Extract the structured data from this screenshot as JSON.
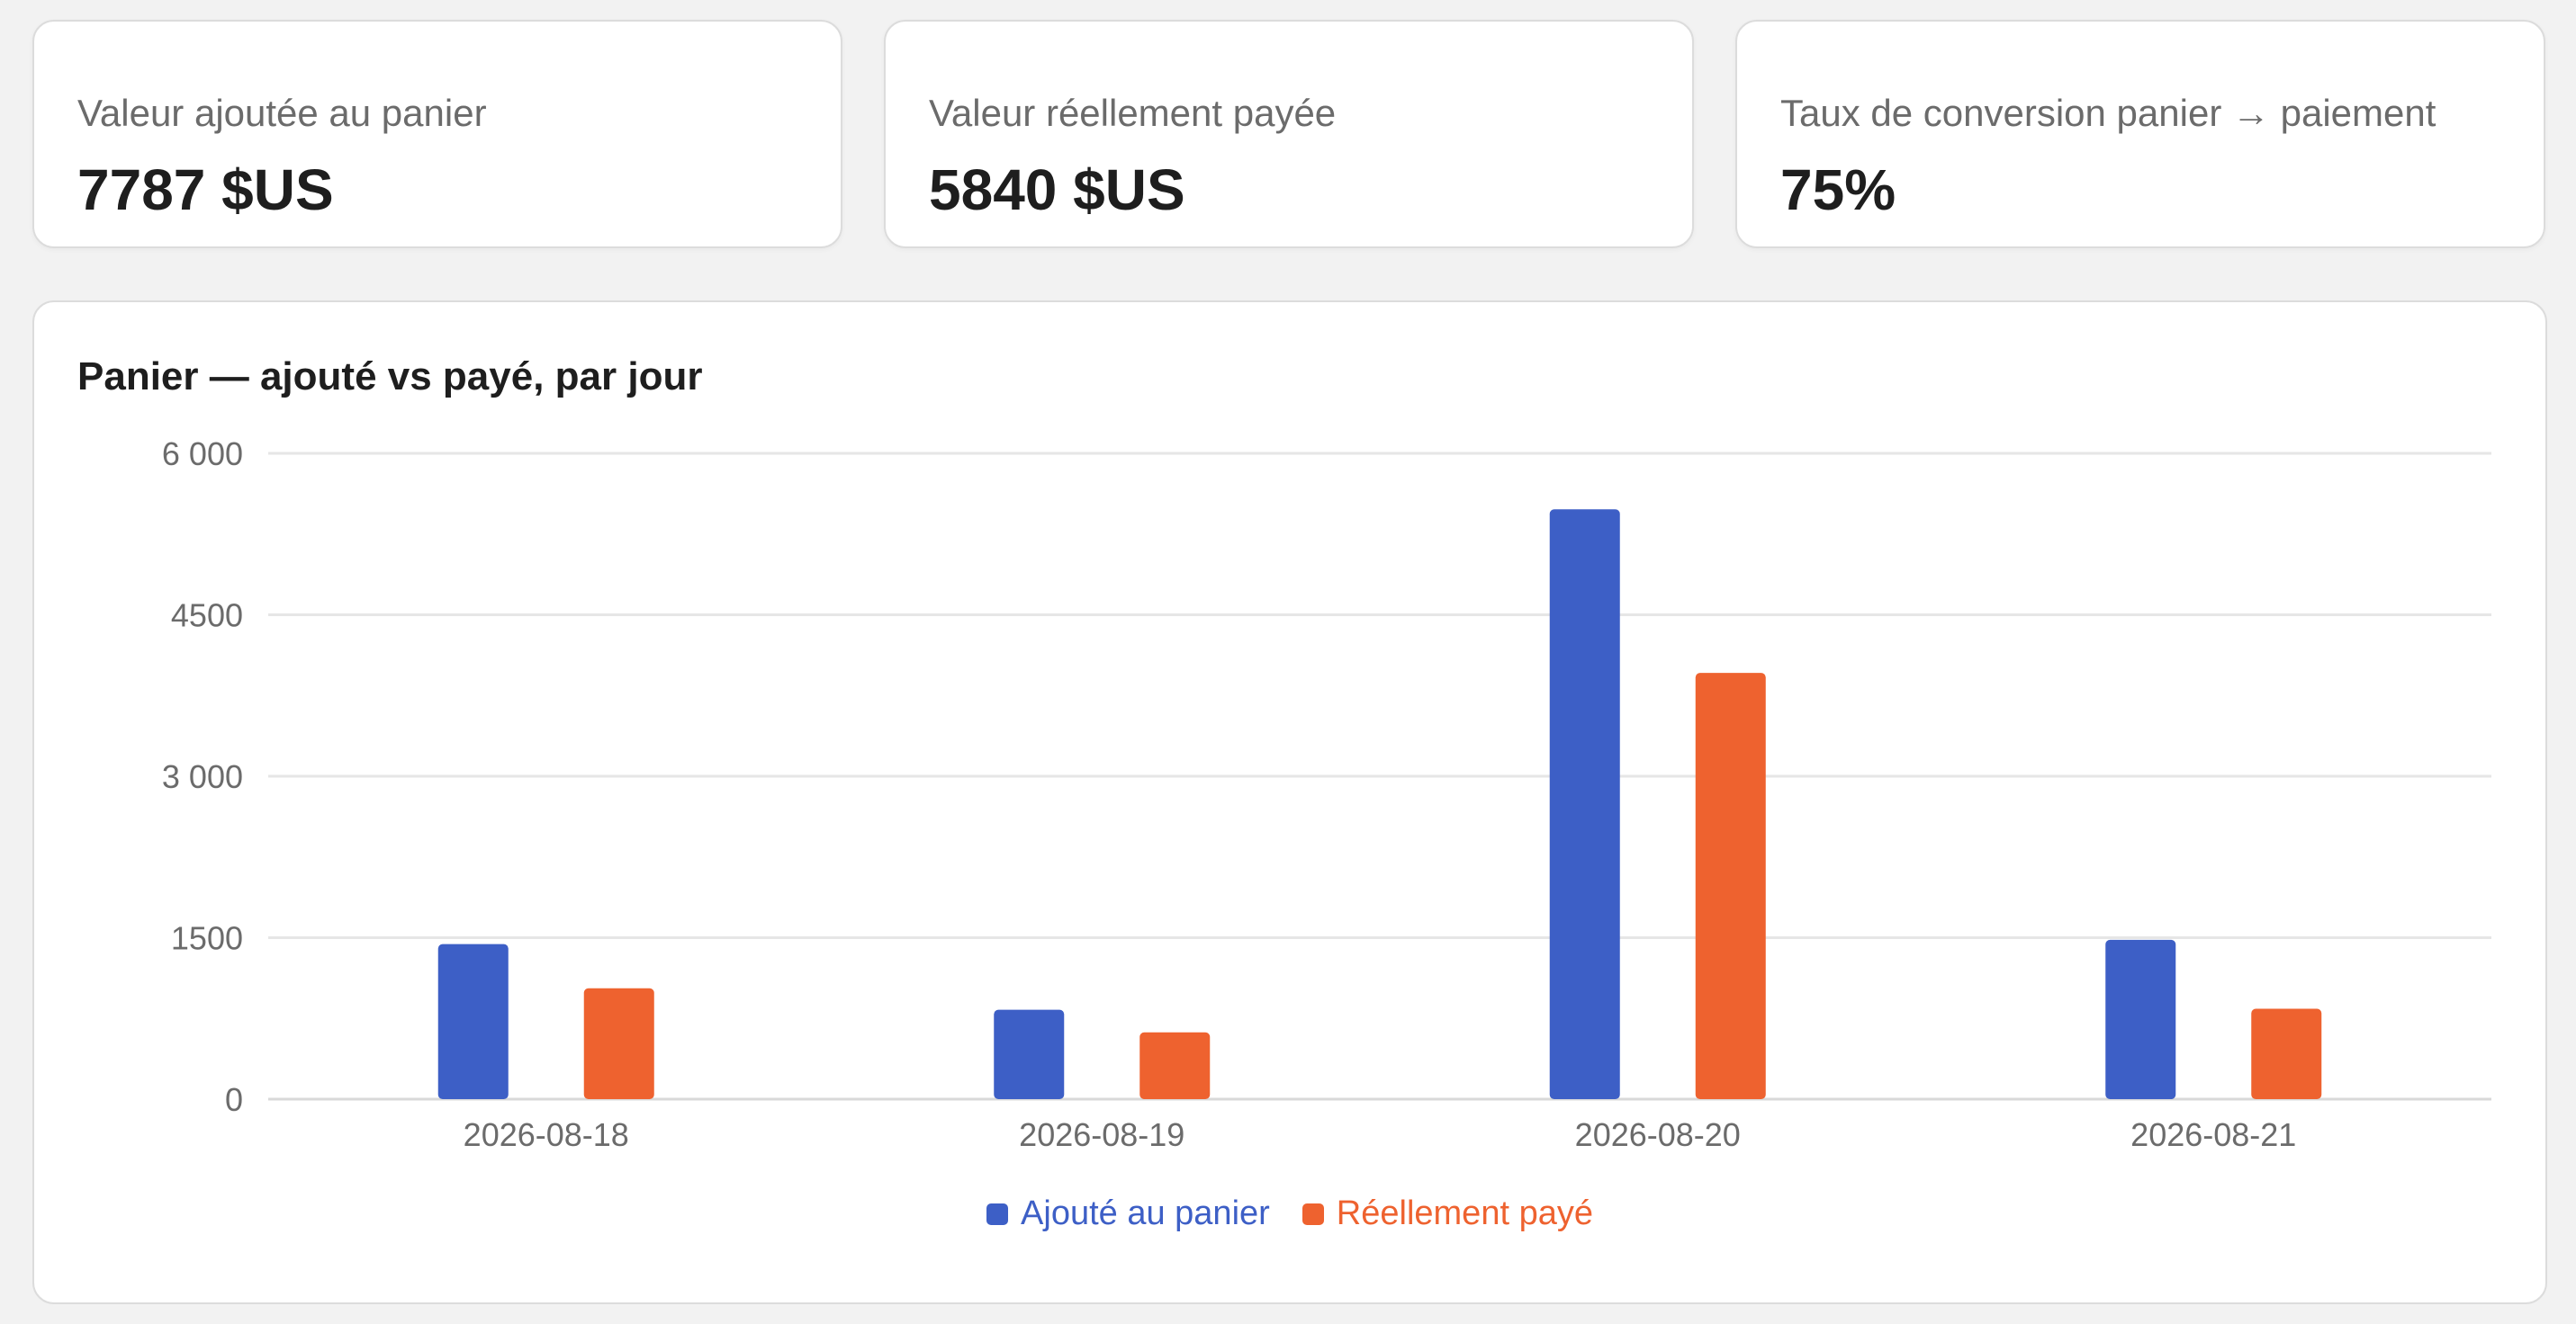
{
  "kpis": [
    {
      "label": "Valeur ajoutée au panier",
      "value": "7787 $US"
    },
    {
      "label": "Valeur réellement payée",
      "value": "5840 $US"
    },
    {
      "label": "Taux de conversion panier → paiement",
      "value": "75%"
    }
  ],
  "chart_data": {
    "type": "bar",
    "title": "Panier — ajouté vs payé, par jour",
    "xlabel": "",
    "ylabel": "",
    "categories": [
      "2026-08-18",
      "2026-08-19",
      "2026-08-20",
      "2026-08-21"
    ],
    "series": [
      {
        "name": "Ajouté au panier",
        "color": "#3d5fc6",
        "values": [
          1440,
          830,
          5480,
          1480
        ]
      },
      {
        "name": "Réellement payé",
        "color": "#ee622f",
        "values": [
          1030,
          620,
          3960,
          840
        ]
      }
    ],
    "ylim": [
      0,
      6000
    ],
    "yticks": [
      0,
      1500,
      3000,
      4500,
      6000
    ],
    "ytick_labels": [
      "0",
      "1500",
      "3 000",
      "4500",
      "6 000"
    ],
    "grid": true,
    "legend_position": "bottom"
  }
}
